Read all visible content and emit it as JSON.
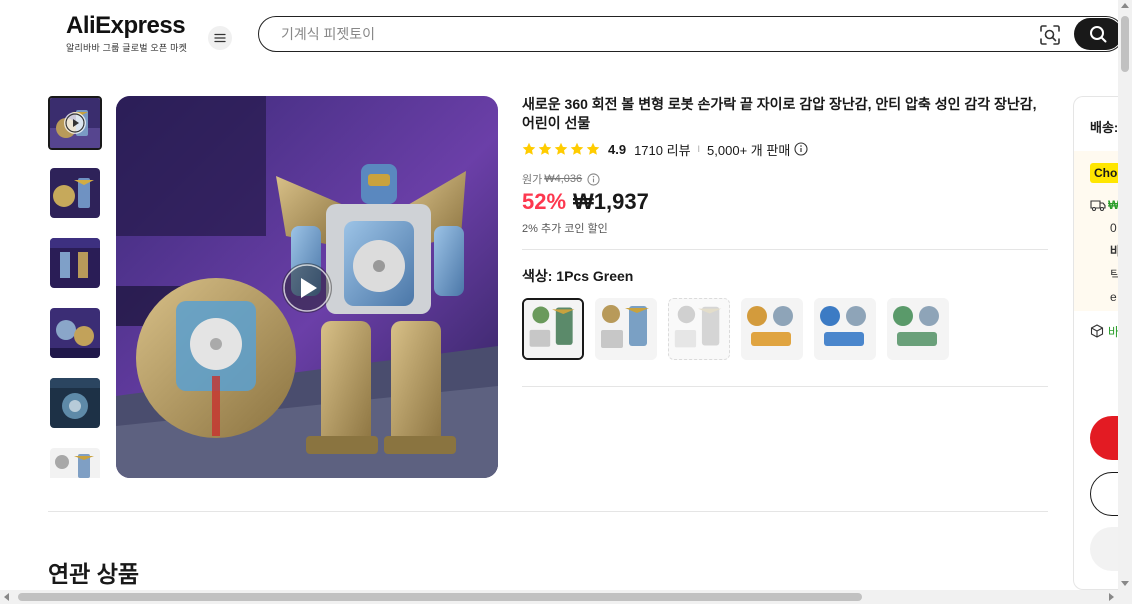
{
  "header": {
    "logo_text": "AliExpress",
    "logo_subtitle": "알리바바 그룹 글로벌 오픈 마켓",
    "search_placeholder": "기계식 피젯토이"
  },
  "gallery": {
    "thumbnail_count": 6,
    "selected_index": 0
  },
  "product": {
    "title": "새로운 360 회전 볼 변형 로봇 손가락 끝 자이로 감압 장난감, 안티 압축 성인 감각 장난감, 어린이 선물",
    "rating": "4.9",
    "reviews": "1710 리뷰",
    "separator": "I",
    "sold": "5,000+ 개 판매",
    "original_label": "원가",
    "original_price": "₩4,036",
    "discount": "52%",
    "price": "₩1,937",
    "coin_text": "2% 추가 코인 할인",
    "color_label": "색상: 1Pcs Green",
    "variant_count": 6,
    "selected_variant": 0
  },
  "related": {
    "heading": "연관 상품"
  },
  "side_panel": {
    "shipping_title": "배송:",
    "choice_badge": "Choi",
    "delivery_short": "₩",
    "line1": "0",
    "line2": "바",
    "line3": "틱",
    "line4": "e",
    "protection": "바"
  },
  "colors": {
    "accent_red": "#fd384f",
    "buy_red": "#e31b23",
    "choice_yellow": "#ffe600",
    "star_gold": "#ffcc00"
  }
}
